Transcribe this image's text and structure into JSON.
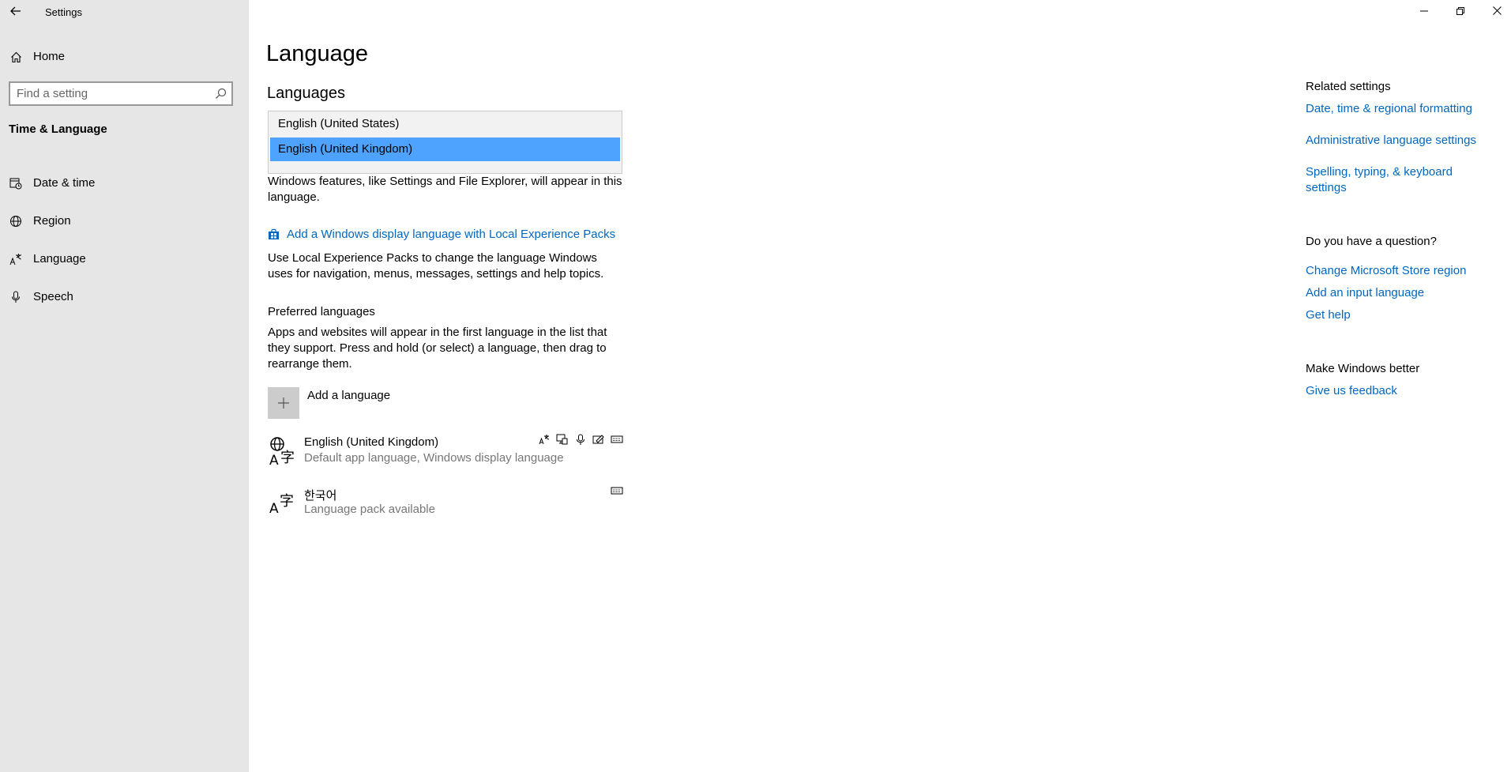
{
  "window": {
    "title": "Settings"
  },
  "sidebar": {
    "home_label": "Home",
    "search_placeholder": "Find a setting",
    "section_title": "Time & Language",
    "items": [
      {
        "label": "Date & time",
        "icon": "calendar-clock-icon"
      },
      {
        "label": "Region",
        "icon": "globe-icon"
      },
      {
        "label": "Language",
        "icon": "language-icon"
      },
      {
        "label": "Speech",
        "icon": "microphone-icon"
      }
    ]
  },
  "main": {
    "page_title": "Language",
    "languages_heading": "Languages",
    "display_language_options": [
      {
        "label": "English (United States)",
        "selected": false
      },
      {
        "label": "English (United Kingdom)",
        "selected": true
      }
    ],
    "display_language_description": "Windows features, like Settings and File Explorer, will appear in this language.",
    "lep_link": "Add a Windows display language with Local Experience Packs",
    "lep_description": "Use Local Experience Packs to change the language Windows uses for navigation, menus, messages, settings and help topics.",
    "preferred_heading": "Preferred languages",
    "preferred_description": "Apps and websites will appear in the first language in the list that they support. Press and hold (or select) a language, then drag to rearrange them.",
    "add_language_label": "Add a language",
    "preferred_languages": [
      {
        "name": "English (United Kingdom)",
        "description": "Default app language, Windows display language",
        "features": [
          "language-pack-icon",
          "display-language-icon",
          "speech-icon",
          "handwriting-icon",
          "keyboard-icon"
        ]
      },
      {
        "name": "한국어",
        "description": "Language pack available",
        "features": [
          "keyboard-icon"
        ]
      }
    ]
  },
  "related": {
    "related_heading": "Related settings",
    "related_links": [
      "Date, time & regional formatting",
      "Administrative language settings",
      "Spelling, typing, & keyboard settings"
    ],
    "question_heading": "Do you have a question?",
    "question_links": [
      "Change Microsoft Store region",
      "Add an input language",
      "Get help"
    ],
    "better_heading": "Make Windows better",
    "feedback_link": "Give us feedback"
  },
  "colors": {
    "sidebar_bg": "#e6e6e6",
    "accent_link": "#0067c0",
    "selected_option": "#4da3ff"
  }
}
